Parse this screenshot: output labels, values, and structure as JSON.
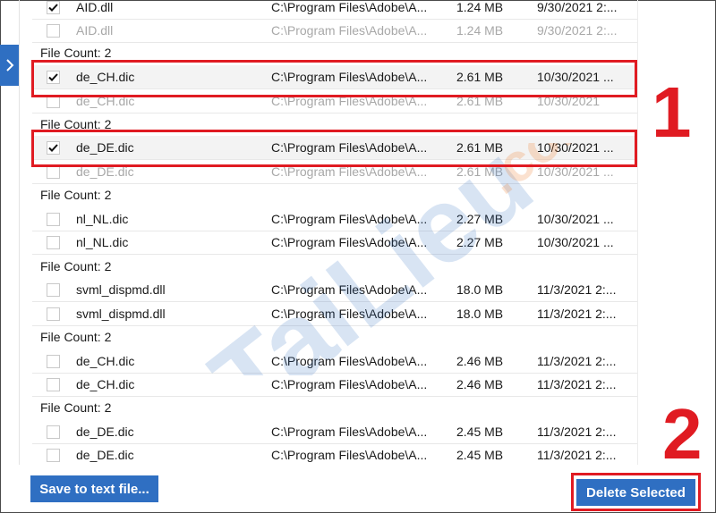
{
  "buttons": {
    "save_label": "Save to text file...",
    "delete_label": "Delete Selected"
  },
  "annotations": {
    "one": "1",
    "two": "2"
  },
  "watermark": "TaiLieu.com",
  "colors": {
    "accent": "#2f6fc2",
    "highlight": "#e01b22"
  },
  "icons": {
    "side_tab": "chevron-right-icon",
    "check": "checkmark-icon"
  },
  "rows": [
    {
      "name": "AID.dll",
      "path": "C:\\Program Files\\Adobe\\A...",
      "size": "1.24 MB",
      "date": "9/30/2021 2:...",
      "checked": true,
      "dim": false
    },
    {
      "name": "AID.dll",
      "path": "C:\\Program Files\\Adobe\\A...",
      "size": "1.24 MB",
      "date": "9/30/2021 2:...",
      "checked": false,
      "dim": true
    },
    {
      "name": "de_CH.dic",
      "path": "C:\\Program Files\\Adobe\\A...",
      "size": "2.61 MB",
      "date": "10/30/2021 ...",
      "checked": true,
      "dim": false
    },
    {
      "name": "de_CH.dic",
      "path": "C:\\Program Files\\Adobe\\A...",
      "size": "2.61 MB",
      "date": "10/30/2021",
      "checked": false,
      "dim": true
    },
    {
      "name": "de_DE.dic",
      "path": "C:\\Program Files\\Adobe\\A...",
      "size": "2.61 MB",
      "date": "10/30/2021 ...",
      "checked": true,
      "dim": false
    },
    {
      "name": "de_DE.dic",
      "path": "C:\\Program Files\\Adobe\\A...",
      "size": "2.61 MB",
      "date": "10/30/2021 ...",
      "checked": false,
      "dim": true
    },
    {
      "name": "nl_NL.dic",
      "path": "C:\\Program Files\\Adobe\\A...",
      "size": "2.27 MB",
      "date": "10/30/2021 ...",
      "checked": false,
      "dim": false
    },
    {
      "name": "nl_NL.dic",
      "path": "C:\\Program Files\\Adobe\\A...",
      "size": "2.27 MB",
      "date": "10/30/2021 ...",
      "checked": false,
      "dim": false
    },
    {
      "name": "svml_dispmd.dll",
      "path": "C:\\Program Files\\Adobe\\A...",
      "size": "18.0 MB",
      "date": "11/3/2021 2:...",
      "checked": false,
      "dim": false
    },
    {
      "name": "svml_dispmd.dll",
      "path": "C:\\Program Files\\Adobe\\A...",
      "size": "18.0 MB",
      "date": "11/3/2021 2:...",
      "checked": false,
      "dim": false
    },
    {
      "name": "de_CH.dic",
      "path": "C:\\Program Files\\Adobe\\A...",
      "size": "2.46 MB",
      "date": "11/3/2021 2:...",
      "checked": false,
      "dim": false
    },
    {
      "name": "de_CH.dic",
      "path": "C:\\Program Files\\Adobe\\A...",
      "size": "2.46 MB",
      "date": "11/3/2021 2:...",
      "checked": false,
      "dim": false
    },
    {
      "name": "de_DE.dic",
      "path": "C:\\Program Files\\Adobe\\A...",
      "size": "2.45 MB",
      "date": "11/3/2021 2:...",
      "checked": false,
      "dim": false
    },
    {
      "name": "de_DE.dic",
      "path": "C:\\Program Files\\Adobe\\A...",
      "size": "2.45 MB",
      "date": "11/3/2021 2:...",
      "checked": false,
      "dim": false
    }
  ],
  "groups": [
    {
      "label": "File Count: 2"
    },
    {
      "label": "File Count: 2"
    },
    {
      "label": "File Count: 2"
    },
    {
      "label": "File Count: 2"
    },
    {
      "label": "File Count: 2"
    },
    {
      "label": "File Count: 2"
    }
  ]
}
